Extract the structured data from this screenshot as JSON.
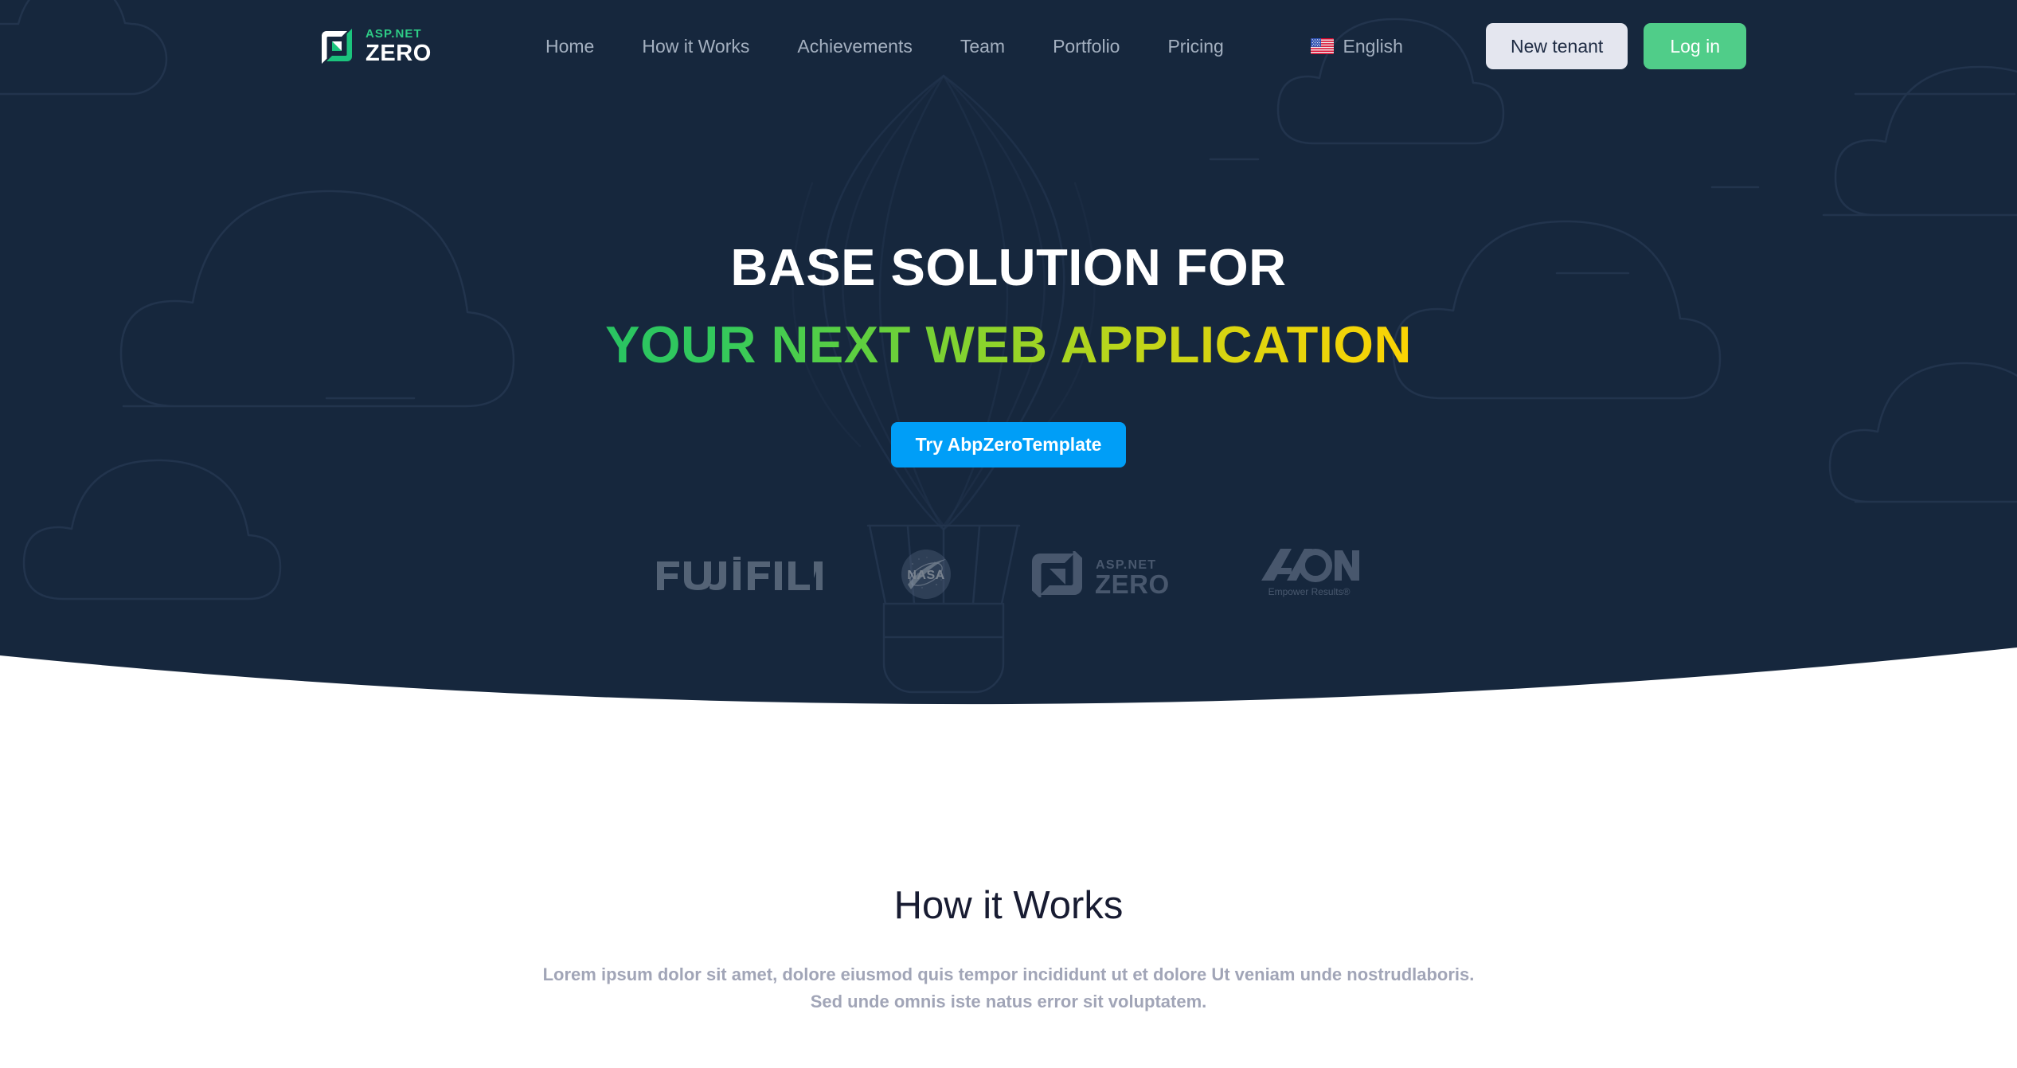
{
  "brand": {
    "icon": "aspnet-zero-logo-icon",
    "top_text": "ASP.NET",
    "bottom_text": "ZERO"
  },
  "nav": {
    "links": [
      {
        "label": "Home"
      },
      {
        "label": "How it Works"
      },
      {
        "label": "Achievements"
      },
      {
        "label": "Team"
      },
      {
        "label": "Portfolio"
      },
      {
        "label": "Pricing"
      }
    ],
    "language": {
      "icon": "us-flag-icon",
      "label": "English"
    },
    "new_tenant_label": "New tenant",
    "login_label": "Log in"
  },
  "hero": {
    "title_line1": "BASE SOLUTION FOR",
    "title_line2": "YOUR NEXT WEB APPLICATION",
    "cta_label": "Try AbpZeroTemplate",
    "background_color": "#16273d",
    "gradient_start": "#29c462",
    "gradient_end": "#fcd404",
    "cta_color": "#009ef7"
  },
  "clients": [
    {
      "name": "FUJIFILM",
      "icon": "fujifilm-logo"
    },
    {
      "name": "NASA",
      "icon": "nasa-logo"
    },
    {
      "name": "ASP.NET ZERO",
      "icon": "aspnet-zero-logo"
    },
    {
      "name": "AON",
      "tagline": "Empower Results®",
      "icon": "aon-logo"
    }
  ],
  "how_it_works": {
    "title": "How it Works",
    "subtitle_line1": "Lorem ipsum dolor sit amet, dolore eiusmod quis tempor incididunt ut et dolore Ut veniam unde nostrudlaboris.",
    "subtitle_line2": "Sed unde omnis iste natus error sit voluptatem."
  },
  "colors": {
    "nav_link": "#a4b0c0",
    "brand_green": "#2ecc86",
    "login_green": "#50cd89",
    "tenant_bg": "#e4e6ef",
    "muted_text": "#a1a5b7",
    "heading_dark": "#181c32"
  }
}
